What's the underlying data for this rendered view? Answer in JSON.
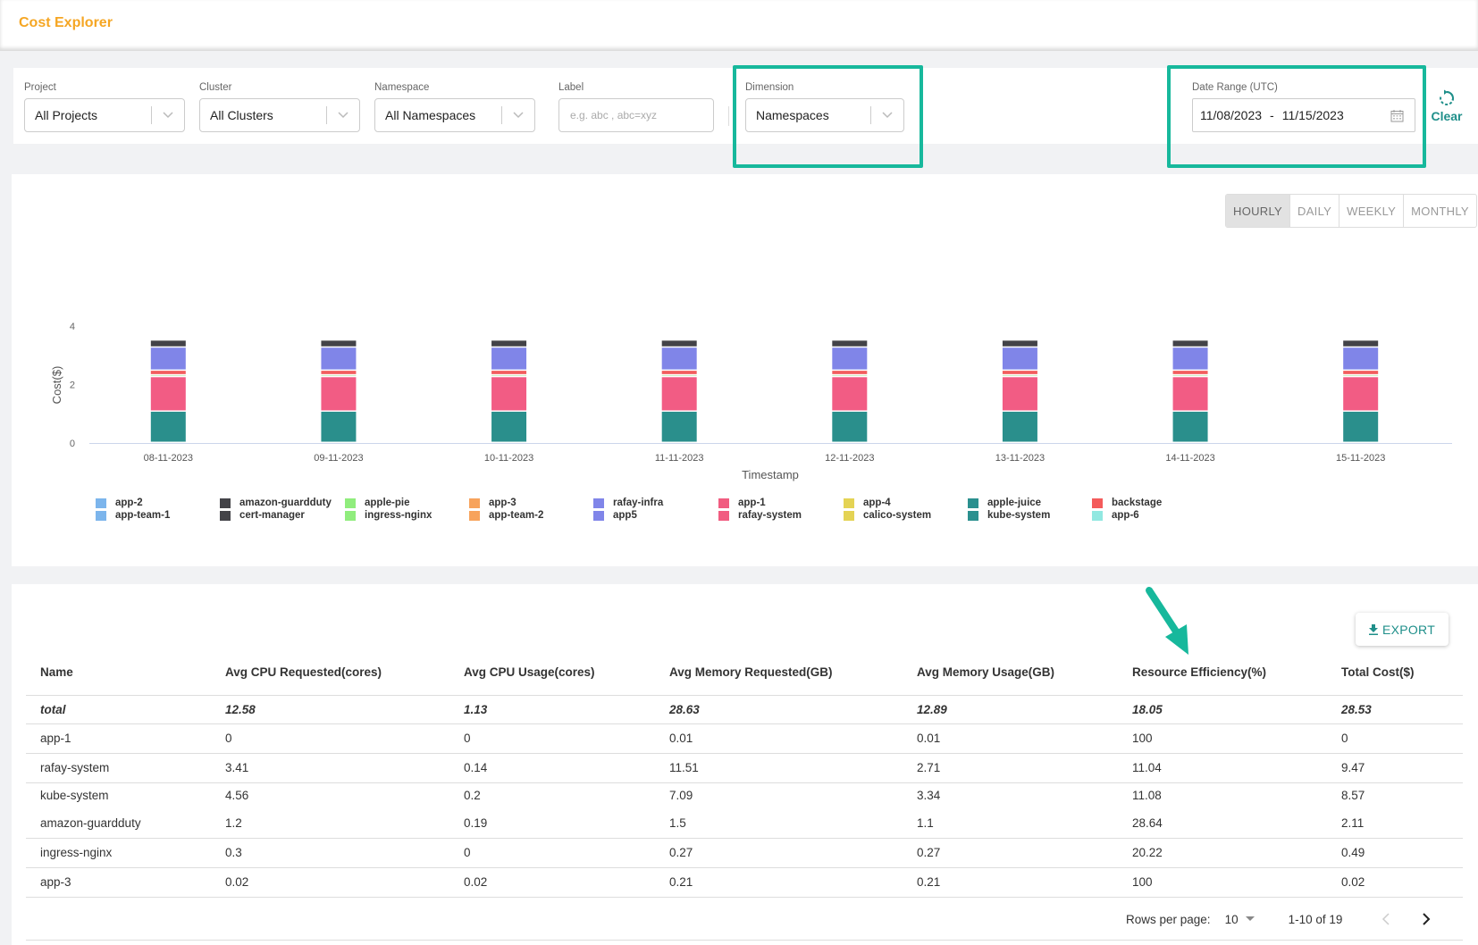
{
  "header": {
    "title": "Cost Explorer"
  },
  "filters": {
    "project": {
      "label": "Project",
      "value": "All Projects"
    },
    "cluster": {
      "label": "Cluster",
      "value": "All Clusters"
    },
    "namespace": {
      "label": "Namespace",
      "value": "All Namespaces"
    },
    "label": {
      "label": "Label",
      "placeholder": "e.g. abc , abc=xyz",
      "value": ""
    },
    "dimension": {
      "label": "Dimension",
      "value": "Namespaces"
    },
    "date_range": {
      "label": "Date Range (UTC)",
      "start": "11/08/2023",
      "separator": "-",
      "end": "11/15/2023"
    },
    "clear_label": "Clear"
  },
  "granularity": {
    "options": [
      "HOURLY",
      "DAILY",
      "WEEKLY",
      "MONTHLY"
    ],
    "selected": "HOURLY"
  },
  "colors": {
    "accent": "#17b89c",
    "brand": "#f5a623",
    "link": "#1f8f8a"
  },
  "chart_data": {
    "type": "bar",
    "stacked": true,
    "title": "",
    "xlabel": "Timestamp",
    "ylabel": "Cost($)",
    "ylim": [
      0,
      4
    ],
    "yticks": [
      0,
      2,
      4
    ],
    "grid": false,
    "legend_position": "bottom",
    "categories": [
      "08-11-2023",
      "09-11-2023",
      "10-11-2023",
      "11-11-2023",
      "12-11-2023",
      "13-11-2023",
      "14-11-2023",
      "15-11-2023"
    ],
    "series": [
      {
        "name": "kube-system",
        "color": "#2a8f8c",
        "values": [
          1.07,
          1.07,
          1.07,
          1.07,
          1.07,
          1.07,
          1.07,
          1.07
        ]
      },
      {
        "name": "rafay-system",
        "color": "#f25c84",
        "values": [
          1.18,
          1.18,
          1.18,
          1.18,
          1.18,
          1.18,
          1.18,
          1.18
        ]
      },
      {
        "name": "ingress-nginx",
        "color": "#96e07e",
        "values": [
          0.06,
          0.06,
          0.06,
          0.06,
          0.06,
          0.06,
          0.06,
          0.06
        ]
      },
      {
        "name": "backstage",
        "color": "#f25e5e",
        "values": [
          0.16,
          0.16,
          0.16,
          0.16,
          0.16,
          0.16,
          0.16,
          0.16
        ]
      },
      {
        "name": "app5",
        "color": "#8085e8",
        "values": [
          0.79,
          0.79,
          0.79,
          0.79,
          0.79,
          0.79,
          0.79,
          0.79
        ]
      },
      {
        "name": "amazon-guardduty",
        "color": "#434348",
        "values": [
          0.24,
          0.24,
          0.24,
          0.24,
          0.24,
          0.24,
          0.24,
          0.24
        ]
      }
    ],
    "legend": [
      {
        "name": "app-2",
        "color": "#7cb5ec"
      },
      {
        "name": "app-team-1",
        "color": "#7cb5ec"
      },
      {
        "name": "amazon-guardduty",
        "color": "#434348"
      },
      {
        "name": "cert-manager",
        "color": "#434348"
      },
      {
        "name": "apple-pie",
        "color": "#90ed7d"
      },
      {
        "name": "ingress-nginx",
        "color": "#90ed7d"
      },
      {
        "name": "app-3",
        "color": "#f7a35c"
      },
      {
        "name": "app-team-2",
        "color": "#f7a35c"
      },
      {
        "name": "rafay-infra",
        "color": "#8085e9"
      },
      {
        "name": "app5",
        "color": "#8085e9"
      },
      {
        "name": "app-1",
        "color": "#f15c80"
      },
      {
        "name": "rafay-system",
        "color": "#f15c80"
      },
      {
        "name": "app-4",
        "color": "#e4d354"
      },
      {
        "name": "calico-system",
        "color": "#e4d354"
      },
      {
        "name": "apple-juice",
        "color": "#2b908f"
      },
      {
        "name": "kube-system",
        "color": "#2b908f"
      },
      {
        "name": "backstage",
        "color": "#f45b5b"
      },
      {
        "name": "app-6",
        "color": "#91e8e1"
      }
    ]
  },
  "table": {
    "export_label": "EXPORT",
    "columns": [
      "Name",
      "Avg CPU Requested(cores)",
      "Avg CPU Usage(cores)",
      "Avg Memory Requested(GB)",
      "Avg Memory Usage(GB)",
      "Resource Efficiency(%)",
      "Total Cost($)"
    ],
    "total": [
      "total",
      "12.58",
      "1.13",
      "28.63",
      "12.89",
      "18.05",
      "28.53"
    ],
    "rows": [
      [
        "app-1",
        "0",
        "0",
        "0.01",
        "0.01",
        "100",
        "0"
      ],
      [
        "rafay-system",
        "3.41",
        "0.14",
        "11.51",
        "2.71",
        "11.04",
        "9.47"
      ],
      [
        "kube-system",
        "4.56",
        "0.2",
        "7.09",
        "3.34",
        "11.08",
        "8.57"
      ],
      [
        "amazon-guardduty",
        "1.2",
        "0.19",
        "1.5",
        "1.1",
        "28.64",
        "2.11"
      ],
      [
        "ingress-nginx",
        "0.3",
        "0",
        "0.27",
        "0.27",
        "20.22",
        "0.49"
      ],
      [
        "app-3",
        "0.02",
        "0.02",
        "0.21",
        "0.21",
        "100",
        "0.02"
      ]
    ]
  },
  "pagination": {
    "rows_per_page_label": "Rows per page:",
    "rows_per_page": "10",
    "range": "1-10 of 19"
  }
}
